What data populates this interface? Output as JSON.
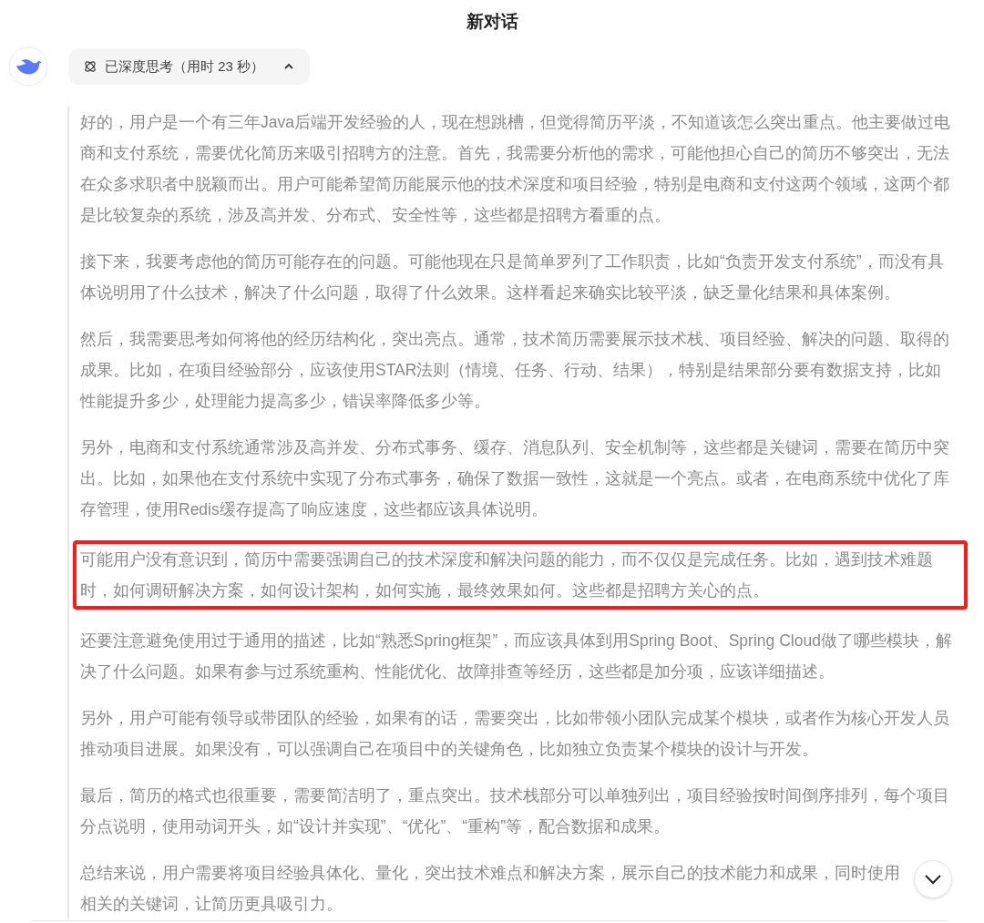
{
  "header": {
    "title": "新对话"
  },
  "thinking_toggle": {
    "label": "已深度思考（用时 23 秒）",
    "expanded": true
  },
  "paragraphs": [
    {
      "text": "好的，用户是一个有三年Java后端开发经验的人，现在想跳槽，但觉得简历平淡，不知道该怎么突出重点。他主要做过电商和支付系统，需要优化简历来吸引招聘方的注意。首先，我需要分析他的需求，可能他担心自己的简历不够突出，无法在众多求职者中脱颖而出。用户可能希望简历能展示他的技术深度和项目经验，特别是电商和支付这两个领域，这两个都是比较复杂的系统，涉及高并发、分布式、安全性等，这些都是招聘方看重的点。",
      "highlighted": false
    },
    {
      "text": "接下来，我要考虑他的简历可能存在的问题。可能他现在只是简单罗列了工作职责，比如“负责开发支付系统”，而没有具体说明用了什么技术，解决了什么问题，取得了什么效果。这样看起来确实比较平淡，缺乏量化结果和具体案例。",
      "highlighted": false
    },
    {
      "text": "然后，我需要思考如何将他的经历结构化，突出亮点。通常，技术简历需要展示技术栈、项目经验、解决的问题、取得的成果。比如，在项目经验部分，应该使用STAR法则（情境、任务、行动、结果），特别是结果部分要有数据支持，比如性能提升多少，处理能力提高多少，错误率降低多少等。",
      "highlighted": false
    },
    {
      "text": "另外，电商和支付系统通常涉及高并发、分布式事务、缓存、消息队列、安全机制等，这些都是关键词，需要在简历中突出。比如，如果他在支付系统中实现了分布式事务，确保了数据一致性，这就是一个亮点。或者，在电商系统中优化了库存管理，使用Redis缓存提高了响应速度，这些都应该具体说明。",
      "highlighted": false
    },
    {
      "text": "可能用户没有意识到，简历中需要强调自己的技术深度和解决问题的能力，而不仅仅是完成任务。比如，遇到技术难题时，如何调研解决方案，如何设计架构，如何实施，最终效果如何。这些都是招聘方关心的点。",
      "highlighted": true
    },
    {
      "text": "还要注意避免使用过于通用的描述，比如“熟悉Spring框架”，而应该具体到用Spring Boot、Spring Cloud做了哪些模块，解决了什么问题。如果有参与过系统重构、性能优化、故障排查等经历，这些都是加分项，应该详细描述。",
      "highlighted": false
    },
    {
      "text": "另外，用户可能有领导或带团队的经验，如果有的话，需要突出，比如带领小团队完成某个模块，或者作为核心开发人员推动项目进展。如果没有，可以强调自己在项目中的关键角色，比如独立负责某个模块的设计与开发。",
      "highlighted": false
    },
    {
      "text": "最后，简历的格式也很重要，需要简洁明了，重点突出。技术栈部分可以单独列出，项目经验按时间倒序排列，每个项目分点说明，使用动词开头，如“设计并实现”、“优化”、“重构”等，配合数据和成果。",
      "highlighted": false
    }
  ],
  "last_paragraph_lines": [
    "总结来说，用户需要将项目经验具体化、量化，突出技术难点和解决方案，展示自己的技术能力和成果，同时使用",
    "相关的关键词，让简历更具吸引力。"
  ]
}
